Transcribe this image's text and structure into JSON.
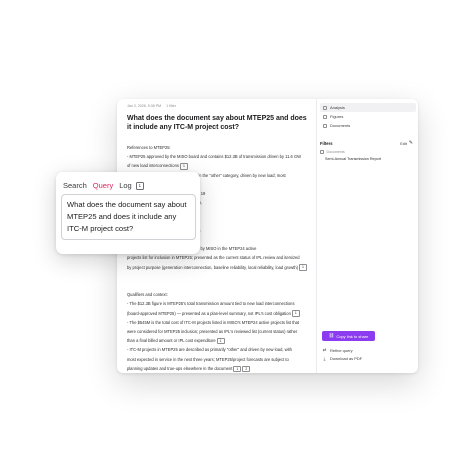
{
  "meta": {
    "date": "Jan 3, 2026, 5:38 PM",
    "filter_count": "1 filter"
  },
  "question": "What does the document say about MTEP25 and does it include any ITC-M project cost?",
  "answer": {
    "lines": [
      {
        "text": "References to MTEP25:",
        "cite": ""
      },
      {
        "text": "- MTEP25 approved by the MISO board and contains $12.3B of transmission driven by 11.6 GW",
        "cite": ""
      },
      {
        "text": "of new load interconnections",
        "cite": "1"
      },
      {
        "text": "- ITC-M MTEP25 projects are primarily in the \"other\" category, driven by new load; most",
        "cite": ""
      },
      {
        "text": "",
        "cite": ""
      },
      {
        "text": "for inclusion in MTEP25) which included 19",
        "cite": ""
      },
      {
        "text": "breakdown: 8 generation interconnection,",
        "cite": ""
      },
      {
        "text": "",
        "cite": ""
      },
      {
        "text": "",
        "cite": ""
      },
      {
        "text": "of 11.6 GW of new load interconnections",
        "cite": ""
      },
      {
        "text": "",
        "cite": ""
      },
      {
        "text": "- ITC-M MTEP25 projects are described by MISO in the MTEP24 active",
        "cite": ""
      },
      {
        "text": "projects list for inclusion in MTEP25; presented as the current status of IPL review and itemized",
        "cite": ""
      },
      {
        "text": "by project purpose (generation interconnection, baseline reliability, local reliability, load growth)",
        "cite": "1"
      },
      {
        "text": "",
        "cite": ""
      },
      {
        "text": "",
        "cite": ""
      },
      {
        "text": "Qualifiers and context:",
        "cite": ""
      },
      {
        "text": "- The $12.3B figure is MTEP25's total transmission amount tied to new load interconnections",
        "cite": ""
      },
      {
        "text": "(board-approved MTEP25) — presented as a plan-level summary, not IPL's cost obligation",
        "cite": "1"
      },
      {
        "text": "- The $545M is the total cost of ITC-M projects listed in MISO's MTEP24 active projects list that",
        "cite": ""
      },
      {
        "text": "were considered for MTEP25 inclusion; presented as IPL's reviewed list (current status) rather",
        "cite": ""
      },
      {
        "text": "than a final billed amount or IPL cost expenditure",
        "cite": "1"
      },
      {
        "text": "- ITC-M projects in MTEP25 are described as primarily \"other\" and driven by new load, with",
        "cite": ""
      },
      {
        "text": "most expected in service in the next three years; MTEP25/project forecasts are subject to",
        "cite": ""
      },
      {
        "text": "planning updates and true-ups elsewhere in the document",
        "cite": "1"
      }
    ],
    "final_cite": "2"
  },
  "sidebar": {
    "nav": [
      {
        "label": "Analysis",
        "active": true
      },
      {
        "label": "Figures",
        "active": false
      },
      {
        "label": "Documents",
        "active": false
      }
    ],
    "filters_label": "Filters",
    "edit_label": "Edit",
    "filter_group": "Documents",
    "filter_value": "Semi-Annual Transmission Report",
    "share_label": "Copy link to share",
    "refine_label": "Refine query",
    "download_label": "Download as PDF"
  },
  "popup": {
    "tabs": [
      {
        "label": "Search",
        "active": false
      },
      {
        "label": "Query",
        "active": true
      },
      {
        "label": "Log",
        "active": false
      }
    ],
    "log_count": "1",
    "query_text": "What does the document say about MTEP25 and does it include any ITC-M project cost?"
  },
  "colors": {
    "accent": "#8b3bf0",
    "active_tab": "#e0245e"
  }
}
